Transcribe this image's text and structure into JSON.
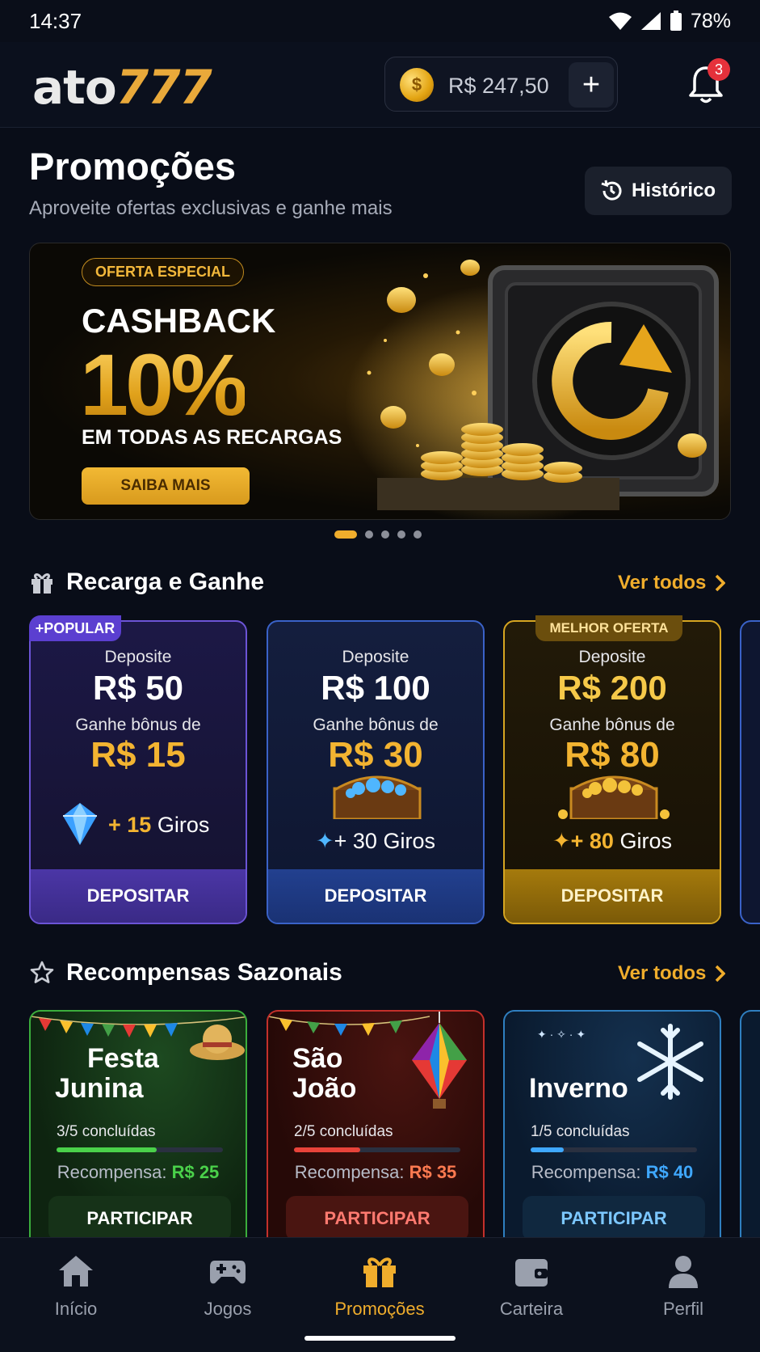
{
  "status": {
    "time": "14:37",
    "battery": "78%"
  },
  "header": {
    "logo_main": "ato",
    "logo_num": "777",
    "balance": "R$ 247,50",
    "add": "+",
    "notification_count": "3"
  },
  "page": {
    "title": "Promoções",
    "subtitle": "Aproveite ofertas exclusivas e ganhe mais",
    "history_label": "Histórico"
  },
  "banner": {
    "tag": "OFERTA ESPECIAL",
    "title": "CASHBACK",
    "percent": "10%",
    "subtitle": "EM TODAS AS RECARGAS",
    "cta": "SAIBA MAIS",
    "slide_active": 1,
    "slide_count": 5
  },
  "recharge": {
    "title": "Recarga e Ganhe",
    "see_all": "Ver todos",
    "cards": [
      {
        "tag": "+POPULAR",
        "deposit_label": "Deposite",
        "deposit": "R$ 50",
        "bonus_label": "Ganhe bônus de",
        "bonus": "R$ 15",
        "spins_prefix": "+ 15",
        "spins_word": "Giros",
        "cta": "DEPOSITAR"
      },
      {
        "tag": "",
        "deposit_label": "Deposite",
        "deposit": "R$ 100",
        "bonus_label": "Ganhe bônus de",
        "bonus": "R$ 30",
        "spins_prefix": "+ 30",
        "spins_word": "Giros",
        "cta": "DEPOSITAR"
      },
      {
        "tag": "MELHOR OFERTA",
        "deposit_label": "Deposite",
        "deposit": "R$ 200",
        "bonus_label": "Ganhe bônus de",
        "bonus": "R$ 80",
        "spins_prefix": "+ 80",
        "spins_word": "Giros",
        "cta": "DEPOSITAR"
      }
    ]
  },
  "seasonal": {
    "title": "Recompensas Sazonais",
    "see_all": "Ver todos",
    "cards": [
      {
        "title_l1": "Festa",
        "title_l2": "Junina",
        "progress_text": "3/5 concluídas",
        "progress": 0.6,
        "reward_label": "Recompensa:",
        "reward": "R$ 25",
        "cta": "PARTICIPAR",
        "color": "#4ad14a"
      },
      {
        "title_l1": "São",
        "title_l2": "João",
        "progress_text": "2/5 concluídas",
        "progress": 0.4,
        "reward_label": "Recompensa:",
        "reward": "R$ 35",
        "cta": "PARTICIPAR",
        "color": "#e8433a"
      },
      {
        "title_l1": "",
        "title_l2": "Inverno",
        "progress_text": "1/5 concluídas",
        "progress": 0.2,
        "reward_label": "Recompensa:",
        "reward": "R$ 40",
        "cta": "PARTICIPAR",
        "color": "#3fa8ff"
      }
    ]
  },
  "nav": {
    "items": [
      {
        "label": "Início",
        "icon": "home-icon"
      },
      {
        "label": "Jogos",
        "icon": "gamepad-icon"
      },
      {
        "label": "Promoções",
        "icon": "gift-icon"
      },
      {
        "label": "Carteira",
        "icon": "wallet-icon"
      },
      {
        "label": "Perfil",
        "icon": "user-icon"
      }
    ],
    "active": "Promoções"
  },
  "colors": {
    "accent": "#f0ad2c",
    "background": "#090d18"
  }
}
